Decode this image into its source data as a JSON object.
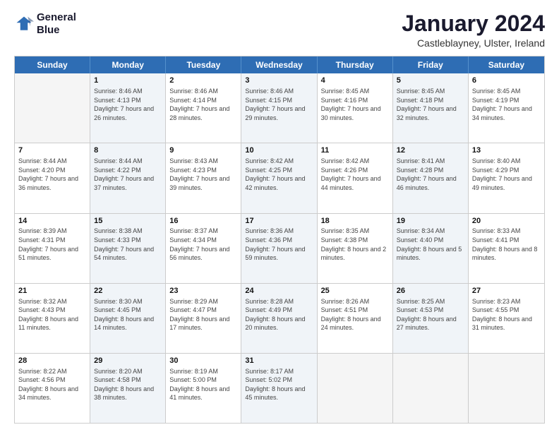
{
  "logo": {
    "line1": "General",
    "line2": "Blue"
  },
  "title": "January 2024",
  "subtitle": "Castleblayney, Ulster, Ireland",
  "days": [
    "Sunday",
    "Monday",
    "Tuesday",
    "Wednesday",
    "Thursday",
    "Friday",
    "Saturday"
  ],
  "weeks": [
    [
      {
        "num": "",
        "sunrise": "",
        "sunset": "",
        "daylight": "",
        "shaded": false,
        "empty": true
      },
      {
        "num": "1",
        "sunrise": "Sunrise: 8:46 AM",
        "sunset": "Sunset: 4:13 PM",
        "daylight": "Daylight: 7 hours and 26 minutes.",
        "shaded": true
      },
      {
        "num": "2",
        "sunrise": "Sunrise: 8:46 AM",
        "sunset": "Sunset: 4:14 PM",
        "daylight": "Daylight: 7 hours and 28 minutes.",
        "shaded": false
      },
      {
        "num": "3",
        "sunrise": "Sunrise: 8:46 AM",
        "sunset": "Sunset: 4:15 PM",
        "daylight": "Daylight: 7 hours and 29 minutes.",
        "shaded": true
      },
      {
        "num": "4",
        "sunrise": "Sunrise: 8:45 AM",
        "sunset": "Sunset: 4:16 PM",
        "daylight": "Daylight: 7 hours and 30 minutes.",
        "shaded": false
      },
      {
        "num": "5",
        "sunrise": "Sunrise: 8:45 AM",
        "sunset": "Sunset: 4:18 PM",
        "daylight": "Daylight: 7 hours and 32 minutes.",
        "shaded": true
      },
      {
        "num": "6",
        "sunrise": "Sunrise: 8:45 AM",
        "sunset": "Sunset: 4:19 PM",
        "daylight": "Daylight: 7 hours and 34 minutes.",
        "shaded": false
      }
    ],
    [
      {
        "num": "7",
        "sunrise": "Sunrise: 8:44 AM",
        "sunset": "Sunset: 4:20 PM",
        "daylight": "Daylight: 7 hours and 36 minutes.",
        "shaded": false
      },
      {
        "num": "8",
        "sunrise": "Sunrise: 8:44 AM",
        "sunset": "Sunset: 4:22 PM",
        "daylight": "Daylight: 7 hours and 37 minutes.",
        "shaded": true
      },
      {
        "num": "9",
        "sunrise": "Sunrise: 8:43 AM",
        "sunset": "Sunset: 4:23 PM",
        "daylight": "Daylight: 7 hours and 39 minutes.",
        "shaded": false
      },
      {
        "num": "10",
        "sunrise": "Sunrise: 8:42 AM",
        "sunset": "Sunset: 4:25 PM",
        "daylight": "Daylight: 7 hours and 42 minutes.",
        "shaded": true
      },
      {
        "num": "11",
        "sunrise": "Sunrise: 8:42 AM",
        "sunset": "Sunset: 4:26 PM",
        "daylight": "Daylight: 7 hours and 44 minutes.",
        "shaded": false
      },
      {
        "num": "12",
        "sunrise": "Sunrise: 8:41 AM",
        "sunset": "Sunset: 4:28 PM",
        "daylight": "Daylight: 7 hours and 46 minutes.",
        "shaded": true
      },
      {
        "num": "13",
        "sunrise": "Sunrise: 8:40 AM",
        "sunset": "Sunset: 4:29 PM",
        "daylight": "Daylight: 7 hours and 49 minutes.",
        "shaded": false
      }
    ],
    [
      {
        "num": "14",
        "sunrise": "Sunrise: 8:39 AM",
        "sunset": "Sunset: 4:31 PM",
        "daylight": "Daylight: 7 hours and 51 minutes.",
        "shaded": false
      },
      {
        "num": "15",
        "sunrise": "Sunrise: 8:38 AM",
        "sunset": "Sunset: 4:33 PM",
        "daylight": "Daylight: 7 hours and 54 minutes.",
        "shaded": true
      },
      {
        "num": "16",
        "sunrise": "Sunrise: 8:37 AM",
        "sunset": "Sunset: 4:34 PM",
        "daylight": "Daylight: 7 hours and 56 minutes.",
        "shaded": false
      },
      {
        "num": "17",
        "sunrise": "Sunrise: 8:36 AM",
        "sunset": "Sunset: 4:36 PM",
        "daylight": "Daylight: 7 hours and 59 minutes.",
        "shaded": true
      },
      {
        "num": "18",
        "sunrise": "Sunrise: 8:35 AM",
        "sunset": "Sunset: 4:38 PM",
        "daylight": "Daylight: 8 hours and 2 minutes.",
        "shaded": false
      },
      {
        "num": "19",
        "sunrise": "Sunrise: 8:34 AM",
        "sunset": "Sunset: 4:40 PM",
        "daylight": "Daylight: 8 hours and 5 minutes.",
        "shaded": true
      },
      {
        "num": "20",
        "sunrise": "Sunrise: 8:33 AM",
        "sunset": "Sunset: 4:41 PM",
        "daylight": "Daylight: 8 hours and 8 minutes.",
        "shaded": false
      }
    ],
    [
      {
        "num": "21",
        "sunrise": "Sunrise: 8:32 AM",
        "sunset": "Sunset: 4:43 PM",
        "daylight": "Daylight: 8 hours and 11 minutes.",
        "shaded": false
      },
      {
        "num": "22",
        "sunrise": "Sunrise: 8:30 AM",
        "sunset": "Sunset: 4:45 PM",
        "daylight": "Daylight: 8 hours and 14 minutes.",
        "shaded": true
      },
      {
        "num": "23",
        "sunrise": "Sunrise: 8:29 AM",
        "sunset": "Sunset: 4:47 PM",
        "daylight": "Daylight: 8 hours and 17 minutes.",
        "shaded": false
      },
      {
        "num": "24",
        "sunrise": "Sunrise: 8:28 AM",
        "sunset": "Sunset: 4:49 PM",
        "daylight": "Daylight: 8 hours and 20 minutes.",
        "shaded": true
      },
      {
        "num": "25",
        "sunrise": "Sunrise: 8:26 AM",
        "sunset": "Sunset: 4:51 PM",
        "daylight": "Daylight: 8 hours and 24 minutes.",
        "shaded": false
      },
      {
        "num": "26",
        "sunrise": "Sunrise: 8:25 AM",
        "sunset": "Sunset: 4:53 PM",
        "daylight": "Daylight: 8 hours and 27 minutes.",
        "shaded": true
      },
      {
        "num": "27",
        "sunrise": "Sunrise: 8:23 AM",
        "sunset": "Sunset: 4:55 PM",
        "daylight": "Daylight: 8 hours and 31 minutes.",
        "shaded": false
      }
    ],
    [
      {
        "num": "28",
        "sunrise": "Sunrise: 8:22 AM",
        "sunset": "Sunset: 4:56 PM",
        "daylight": "Daylight: 8 hours and 34 minutes.",
        "shaded": false
      },
      {
        "num": "29",
        "sunrise": "Sunrise: 8:20 AM",
        "sunset": "Sunset: 4:58 PM",
        "daylight": "Daylight: 8 hours and 38 minutes.",
        "shaded": true
      },
      {
        "num": "30",
        "sunrise": "Sunrise: 8:19 AM",
        "sunset": "Sunset: 5:00 PM",
        "daylight": "Daylight: 8 hours and 41 minutes.",
        "shaded": false
      },
      {
        "num": "31",
        "sunrise": "Sunrise: 8:17 AM",
        "sunset": "Sunset: 5:02 PM",
        "daylight": "Daylight: 8 hours and 45 minutes.",
        "shaded": true
      },
      {
        "num": "",
        "sunrise": "",
        "sunset": "",
        "daylight": "",
        "shaded": false,
        "empty": true
      },
      {
        "num": "",
        "sunrise": "",
        "sunset": "",
        "daylight": "",
        "shaded": false,
        "empty": true
      },
      {
        "num": "",
        "sunrise": "",
        "sunset": "",
        "daylight": "",
        "shaded": false,
        "empty": true
      }
    ]
  ]
}
